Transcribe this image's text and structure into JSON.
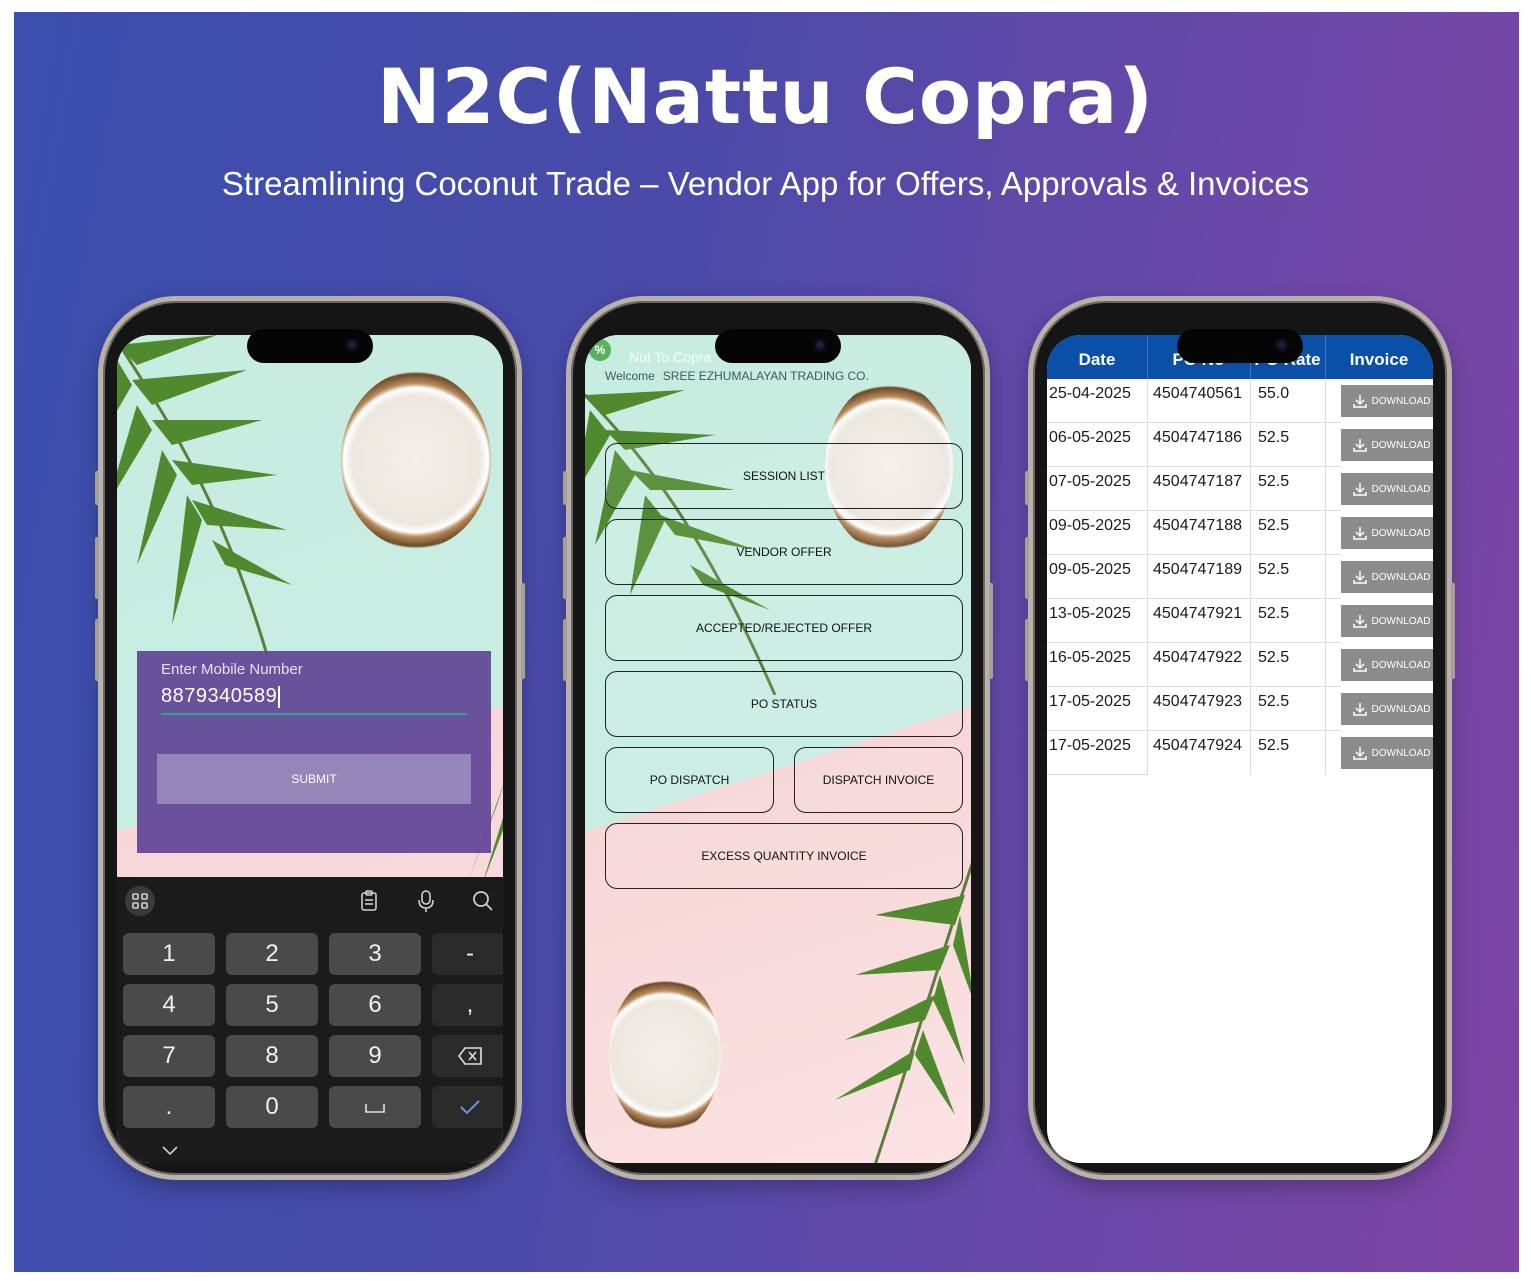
{
  "headline": "N2C(Nattu Copra)",
  "subline": "Streamlining Coconut Trade – Vendor App for Offers, Approvals & Invoices",
  "login_screen": {
    "label": "Enter Mobile Number",
    "mobile_value": "8879340589",
    "submit_label": "SUBMIT",
    "keyboard_keys": [
      "1",
      "2",
      "3",
      "-",
      "4",
      "5",
      "6",
      ",",
      "7",
      "8",
      "9",
      ".",
      "0"
    ]
  },
  "menu_screen": {
    "app_name": "Nut To Copra",
    "welcome_label": "Welcome",
    "company": "SREE EZHUMALAYAN TRADING CO.",
    "buttons": {
      "session_list": "SESSION LIST",
      "vendor_offer": "VENDOR OFFER",
      "accepted_rejected": "ACCEPTED/REJECTED OFFER",
      "po_status": "PO STATUS",
      "po_dispatch": "PO DISPATCH",
      "dispatch_invoice": "DISPATCH INVOICE",
      "excess_quantity": "EXCESS QUANTITY INVOICE"
    }
  },
  "invoice_screen": {
    "headers": {
      "date": "Date",
      "po_no": "PO No",
      "po_rate": "PO Rate",
      "invoice": "Invoice"
    },
    "download_label": "DOWNLOAD",
    "rows": [
      {
        "date": "25-04-2025",
        "po_no": "4504740561",
        "rate": "55.0"
      },
      {
        "date": "06-05-2025",
        "po_no": "4504747186",
        "rate": "52.5"
      },
      {
        "date": "07-05-2025",
        "po_no": "4504747187",
        "rate": "52.5"
      },
      {
        "date": "09-05-2025",
        "po_no": "4504747188",
        "rate": "52.5"
      },
      {
        "date": "09-05-2025",
        "po_no": "4504747189",
        "rate": "52.5"
      },
      {
        "date": "13-05-2025",
        "po_no": "4504747921",
        "rate": "52.5"
      },
      {
        "date": "16-05-2025",
        "po_no": "4504747922",
        "rate": "52.5"
      },
      {
        "date": "17-05-2025",
        "po_no": "4504747923",
        "rate": "52.5"
      },
      {
        "date": "17-05-2025",
        "po_no": "4504747924",
        "rate": "52.5"
      }
    ]
  },
  "colors": {
    "banner_left": "#3a4fae",
    "banner_right": "#7e45a4",
    "table_header": "#0a4fa8",
    "download_button": "#8c8c8c",
    "login_panel": "#604496"
  }
}
